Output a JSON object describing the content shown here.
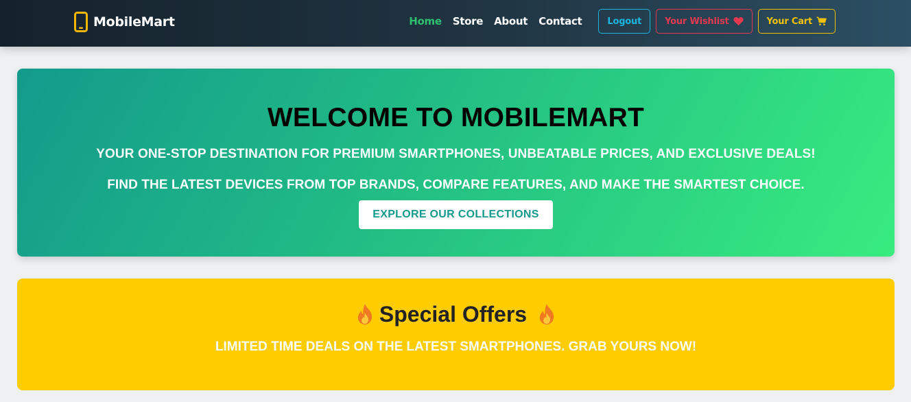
{
  "brand": {
    "name": "MobileMart",
    "icon": "smartphone-icon",
    "icon_color": "#f5b800"
  },
  "nav": {
    "links": [
      "Home",
      "Store",
      "About",
      "Contact"
    ],
    "active_color": "#2fbf71",
    "logout_label": "Logout",
    "wishlist_label": "Your Wishlist",
    "wishlist_icon": "heart-icon",
    "cart_label": "Your Cart",
    "cart_icon": "shopping-cart-icon"
  },
  "hero": {
    "title": "WELCOME TO MOBILEMART",
    "subtitle_1": "YOUR ONE-STOP DESTINATION FOR PREMIUM SMARTPHONES, UNBEATABLE PRICES, AND EXCLUSIVE DEALS!",
    "subtitle_2": "FIND THE LATEST DEVICES FROM TOP BRANDS, COMPARE FEATURES, AND MAKE THE SMARTEST CHOICE.",
    "cta_label": "EXPLORE OUR COLLECTIONS"
  },
  "offers": {
    "title": "Special Offers",
    "icon": "fire-icon",
    "subtitle": "LIMITED TIME DEALS ON THE LATEST SMARTPHONES. GRAB YOURS NOW!"
  },
  "colors": {
    "accent_teal": "#139a8c",
    "accent_green": "#38ec7f",
    "offers_yellow": "#ffcc00",
    "logout": "#1cb5e0",
    "wishlist": "#e63950",
    "cart": "#f2c200"
  }
}
